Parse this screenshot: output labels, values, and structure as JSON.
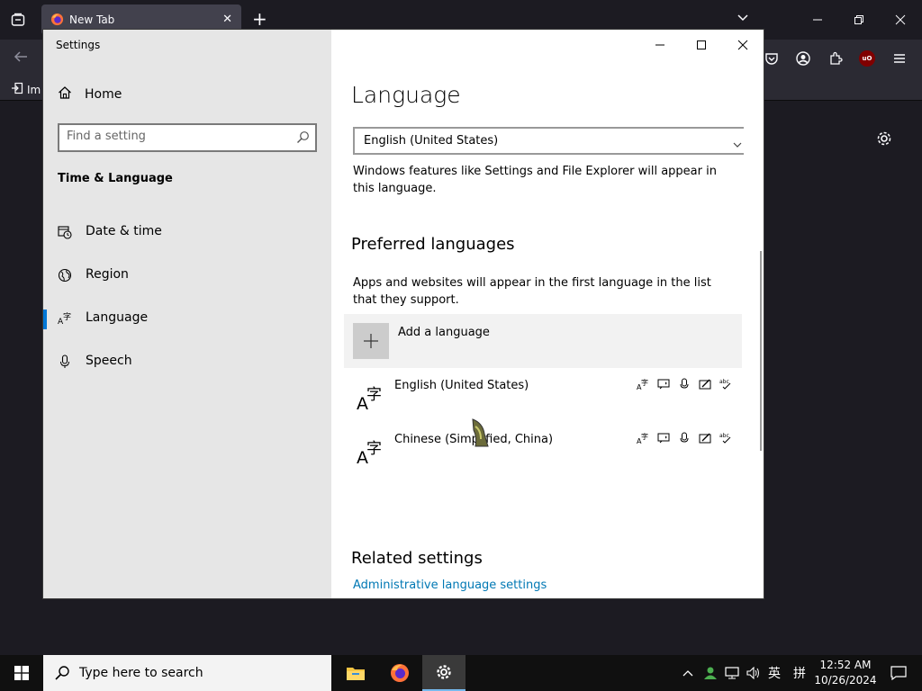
{
  "firefox": {
    "tab_title": "New Tab",
    "bookmark_import": "Im"
  },
  "settings": {
    "window_title": "Settings",
    "home_label": "Home",
    "search_placeholder": "Find a setting",
    "section_title": "Time & Language",
    "nav_items": [
      {
        "label": "Date & time",
        "icon": "calendar-clock-icon"
      },
      {
        "label": "Region",
        "icon": "globe-icon"
      },
      {
        "label": "Language",
        "icon": "language-icon",
        "active": true
      },
      {
        "label": "Speech",
        "icon": "microphone-icon"
      }
    ],
    "page_title": "Language",
    "display_language_value": "English (United States)",
    "display_language_desc": "Windows features like Settings and File Explorer will appear in this language.",
    "preferred_title": "Preferred languages",
    "preferred_desc": "Apps and websites will appear in the first language in the list that they support.",
    "add_language_label": "Add a language",
    "languages": [
      {
        "name": "English (United States)"
      },
      {
        "name": "Chinese (Simplified, China)"
      }
    ],
    "related_title": "Related settings",
    "related_link": "Administrative language settings"
  },
  "taskbar": {
    "search_placeholder": "Type here to search",
    "ime_label": "英",
    "ime_mode": "拼",
    "time": "12:52 AM",
    "date": "10/26/2024"
  },
  "colors": {
    "accent": "#0078d7",
    "link": "#0078b4",
    "sidebar_bg": "#e6e6e6",
    "taskbar_bg": "#101010"
  }
}
